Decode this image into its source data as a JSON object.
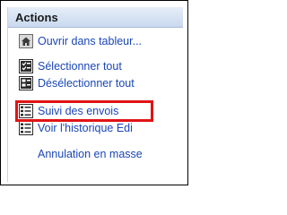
{
  "panel": {
    "title": "Actions",
    "items": [
      {
        "label": "Ouvrir dans tableur...",
        "icon": "home-spreadsheet-icon"
      },
      {
        "label": "Sélectionner tout",
        "icon": "select-all-icon"
      },
      {
        "label": "Désélectionner tout",
        "icon": "deselect-all-icon"
      },
      {
        "label": "Suivi des envois",
        "icon": "list-icon"
      },
      {
        "label": "Voir l'historique Edi",
        "icon": "list-icon"
      },
      {
        "label": "Annulation en masse",
        "icon": ""
      }
    ]
  },
  "highlight": {
    "color": "#e01414"
  },
  "colors": {
    "link": "#1a46b7",
    "header_bg": "#c9d9ee"
  }
}
